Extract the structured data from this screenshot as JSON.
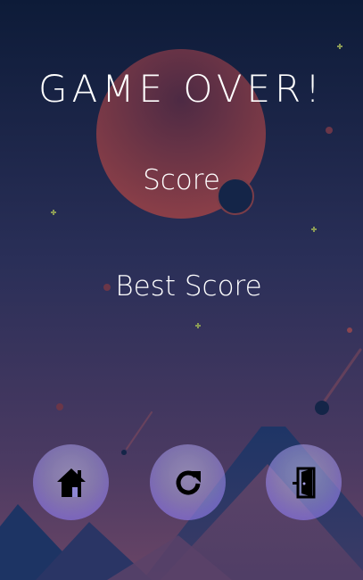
{
  "game_over": {
    "title": "GAME OVER!",
    "score_label": "Score",
    "best_score_label": "Best Score"
  },
  "buttons": [
    {
      "name": "home",
      "icon": "home-icon"
    },
    {
      "name": "restart",
      "icon": "restart-icon"
    },
    {
      "name": "exit",
      "icon": "exit-door-icon"
    }
  ],
  "colors": {
    "sky_top": "#0e1c3a",
    "sky_bottom": "#5a3e63",
    "planet": "#8a3f48",
    "button_fill": "#b3aee6",
    "text": "#ffffff"
  }
}
